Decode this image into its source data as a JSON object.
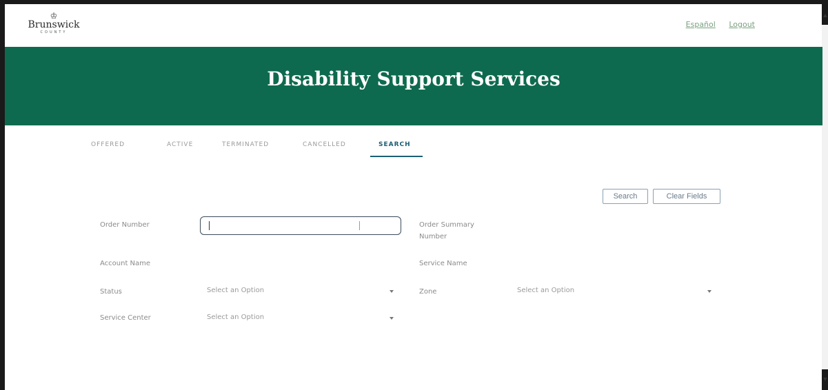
{
  "logo": {
    "crown": "♔",
    "word": "Brunswick",
    "sub": "COUNTY"
  },
  "top_links": {
    "first": "Español",
    "second": "Logout"
  },
  "banner": {
    "title": "Disability Support Services",
    "color": "#0e6a4e"
  },
  "tabs": [
    {
      "label": "OFFERED"
    },
    {
      "label": "ACTIVE"
    },
    {
      "label": "TERMINATED"
    },
    {
      "label": "CANCELLED"
    },
    {
      "label": "SEARCH",
      "active": true
    }
  ],
  "actions": {
    "search_label": "Search",
    "clear_label": "Clear Fields"
  },
  "form": {
    "order_number_label": "Order Number",
    "order_number_value": "",
    "order_summary_label_line1": "Order Summary",
    "order_summary_label_line2": "Number",
    "account_name_label": "Account Name",
    "service_name_label": "Service Name",
    "status_label": "Status",
    "status_value": "Select an Option",
    "zone_label": "Zone",
    "zone_value": "Select an Option",
    "service_center_label": "Service Center",
    "service_center_value": "Select an Option"
  }
}
